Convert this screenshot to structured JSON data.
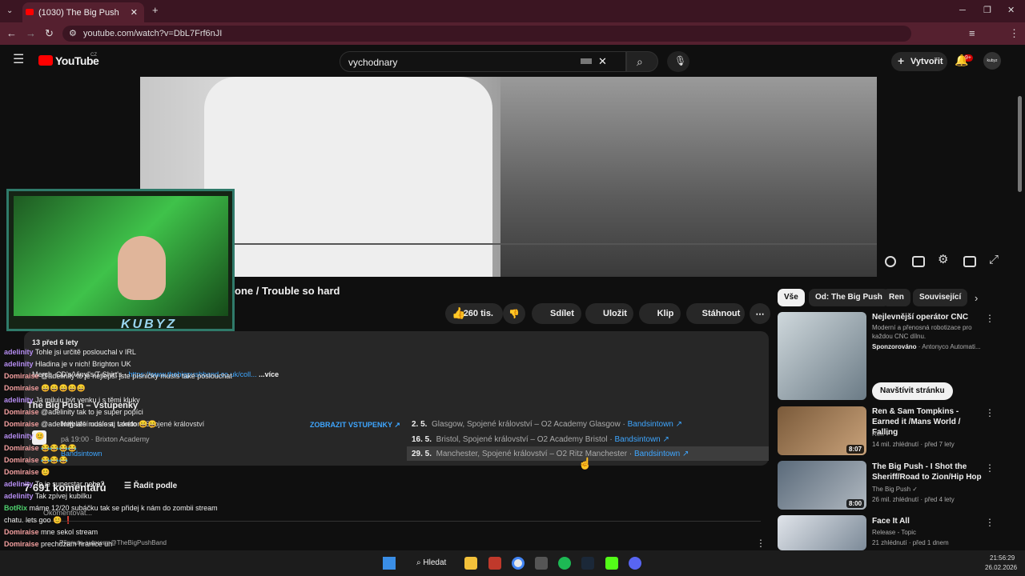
{
  "browser": {
    "tab_title": "(1030) The Big Push - Wade",
    "url": "youtube.com/watch?v=DbL7Frf6nJI",
    "new_tab": "+",
    "win_min": "─",
    "win_max": "❐",
    "win_close": "✕"
  },
  "youtube": {
    "logo_text": "YouTube",
    "country": "CZ",
    "search_value": "vychodnary",
    "create_label": "Vytvořit",
    "notif_count": "9+",
    "avatar_text": "kubyz"
  },
  "video": {
    "title_visible": "one / Trouble so hard",
    "likes": "260 tis.",
    "share": "Sdílet",
    "save": "Uložit",
    "clip": "Klip",
    "download": "Stáhnout",
    "more": "⋯"
  },
  "description": {
    "views": "13",
    "date": "před 6 lety",
    "merch_label": "Merch, CD's/Vinyl's/T-Shirt's - ",
    "merch_link": "https://www.thebigpushband.co.uk/coll...",
    "more": "...více",
    "tickets_header": "The Big Push – Vstupenky",
    "show_tickets": "ZOBRAZIT VSTUPENKY ↗",
    "feat_day": "8",
    "feat_venue": "Nejbližší událost: London, Spojené království",
    "feat_time": "pá 19:00 · Brixton Academy",
    "feat_link": "Bandsintown",
    "tour": [
      {
        "date": "2. 5.",
        "place": "Glasgow, Spojené království – O2 Academy Glasgow",
        "link": "Bandsintown ↗"
      },
      {
        "date": "16. 5.",
        "place": "Bristol, Spojené království – O2 Academy Bristol",
        "link": "Bandsintown ↗"
      },
      {
        "date": "29. 5.",
        "place": "Manchester, Spojené království – O2 Ritz Manchester",
        "link": "Bandsintown ↗"
      }
    ]
  },
  "comments": {
    "count": "7 691 komentářů",
    "sort": "Řadit podle",
    "add": "Okomentovat...",
    "pinned": "Připnuto autorem @TheBigPushBand"
  },
  "chat": [
    {
      "user": "adelinity",
      "msg": "Tohle jsi určitě poslouchal v IRL",
      "cls": "u1"
    },
    {
      "user": "adelinity",
      "msg": "Hladina je v nich! Brighton UK",
      "cls": "u1"
    },
    {
      "user": "Domiraise",
      "msg": "@adelinity to je nejlepší jste písničky musís také poslouchat",
      "cls": "u2"
    },
    {
      "user": "Domiraise",
      "msg": "😄😄😄😄😄",
      "cls": "u2"
    },
    {
      "user": "adelinity",
      "msg": "Já miluju být venku i s těmi kluky",
      "cls": "u1"
    },
    {
      "user": "Domiraise",
      "msg": "@adelinity tak to je super popíci",
      "cls": "u2"
    },
    {
      "user": "Domiraise",
      "msg": "@adelinity ale musís aj takéto 😄😄",
      "cls": "u2"
    },
    {
      "user": "adelinity",
      "msg": "😊",
      "cls": "u1"
    },
    {
      "user": "Domiraise",
      "msg": "😂😂😂😂",
      "cls": "u2"
    },
    {
      "user": "Domiraise",
      "msg": "😂😂😂",
      "cls": "u2"
    },
    {
      "user": "Domiraise",
      "msg": "😊",
      "cls": "u2"
    },
    {
      "user": "adelinity",
      "msg": "To je superstar nebo?",
      "cls": "u1"
    },
    {
      "user": "adelinity",
      "msg": "Tak zpívej kubilku",
      "cls": "u1"
    },
    {
      "user": "BotRix",
      "msg": "máme 12/20 subáčku tak se přidej k nám do zombii stream",
      "cls": "u3"
    },
    {
      "user": "",
      "msg": "chatu. lets goo 😊 ❗",
      "cls": "u3"
    },
    {
      "user": "Domiraise",
      "msg": "mne sekol stream",
      "cls": "u2"
    },
    {
      "user": "Domiraise",
      "msg": "prechdzam hranice uh",
      "cls": "u2"
    },
    {
      "user": "adelinity",
      "msg": "Proč neumíš hrát na kytaru :D",
      "cls": "u1"
    }
  ],
  "sidebar": {
    "chips": [
      "Vše",
      "Od: The Big Push",
      "Ren",
      "Související"
    ],
    "ad": {
      "title": "Nejlevnější operátor CNC",
      "desc": "Moderní a přenosná robotizace pro každou CNC dílnu.",
      "sponsor": "Sponzorováno",
      "advertiser": "· Antonyco Automati...",
      "cta": "Navštívit stránku"
    },
    "items": [
      {
        "title": "Ren & Sam Tompkins - Earned it /Mans World / Falling",
        "channel": "Ren ✓",
        "meta": "14 mil. zhlédnutí · před 7 lety",
        "duration": "8:07"
      },
      {
        "title": "The Big Push - I Shot the Sheriff/Road to Zion/Hip Hop",
        "channel": "The Big Push ✓",
        "meta": "26 mil. zhlédnutí · před 4 lety",
        "duration": "8:00"
      },
      {
        "title": "Face It All",
        "channel": "Release - Topic",
        "meta": "21 zhlédnutí · před 1 dnem",
        "duration": ""
      }
    ]
  },
  "taskbar": {
    "search": "Hledat",
    "time": "21:56:29",
    "date": "26.02.2026"
  },
  "webcam_logo": "KUBYZ"
}
